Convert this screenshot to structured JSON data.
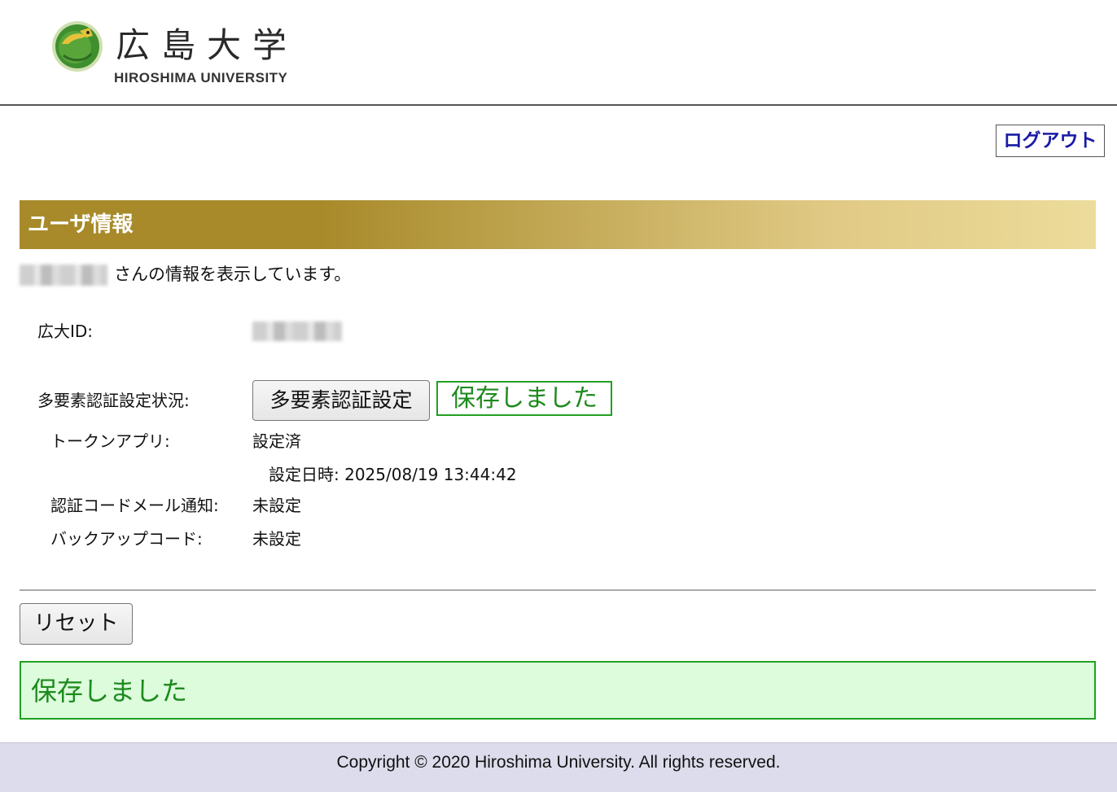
{
  "header": {
    "logo_jp": "広島大学",
    "logo_en": "HIROSHIMA UNIVERSITY"
  },
  "logout_label": "ログアウト",
  "section": {
    "title": "ユーザ情報"
  },
  "intro": {
    "suffix": "さんの情報を表示しています。"
  },
  "fields": {
    "id_label": "広大ID:",
    "mfa_status_label": "多要素認証設定状況:",
    "mfa_button_label": "多要素認証設定",
    "saved_inline": "保存しました",
    "token_app_label": "トークンアプリ:",
    "token_app_value": "設定済",
    "token_app_date": "設定日時: 2025/08/19 13:44:42",
    "email_notify_label": "認証コードメール通知:",
    "email_notify_value": "未設定",
    "backup_code_label": "バックアップコード:",
    "backup_code_value": "未設定"
  },
  "reset_label": "リセット",
  "saved_banner": "保存しました",
  "footer": {
    "copyright": "Copyright © 2020 Hiroshima University. All rights reserved."
  },
  "colors": {
    "section_gradient_start": "#a88a2a",
    "section_gradient_end": "#ecdc9b",
    "saved_green": "#1d8a1d",
    "saved_bg": "#dcfcdc",
    "link_blue": "#1a1aa6",
    "footer_bg": "#dcdcec"
  }
}
